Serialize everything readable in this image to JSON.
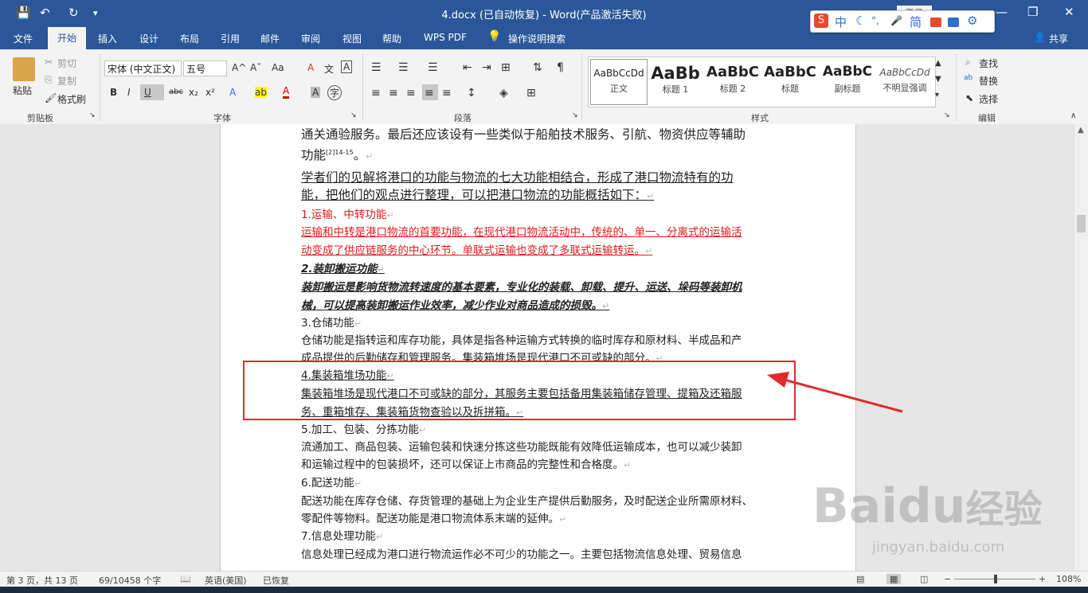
{
  "window": {
    "title": "4.docx (已自动恢复)  -  Word(产品激活失败)",
    "login": "登录",
    "min": "—",
    "restore": "❐",
    "close": "✕"
  },
  "quick_access": {
    "save": "💾",
    "undo": "↶",
    "redo": "↻",
    "more": "▾"
  },
  "ime": {
    "logo": "S",
    "zh": "中",
    "moon": "☾",
    "dots": "°,",
    "mic": "🎤",
    "simp": "简",
    "gear": "⚙"
  },
  "tabs": [
    "文件",
    "开始",
    "插入",
    "设计",
    "布局",
    "引用",
    "邮件",
    "审阅",
    "视图",
    "帮助",
    "WPS PDF",
    "操作说明搜索"
  ],
  "share": "共享",
  "ribbon": {
    "clipboard": {
      "paste": "粘贴",
      "cut": "剪切",
      "copy": "复制",
      "format_painter": "格式刷",
      "label": "剪贴板"
    },
    "font": {
      "name": "宋体 (中文正文)",
      "size": "五号",
      "label": "字体",
      "bold": "B",
      "italic": "I",
      "underline": "U",
      "strike": "abc",
      "sub": "x₂",
      "sup": "x²",
      "grow": "A^",
      "shrink": "Aˇ",
      "case": "Aa",
      "clear": "A",
      "phonetic": "文",
      "border": "A",
      "text_effect": "A",
      "highlight": "ab",
      "color": "A",
      "shade": "A",
      "circle": "字"
    },
    "paragraph": {
      "label": "段落"
    },
    "styles": {
      "label": "样式",
      "items": [
        {
          "sample": "AaBbCcDd",
          "name": "正文"
        },
        {
          "sample": "AaBb",
          "name": "标题 1"
        },
        {
          "sample": "AaBbC",
          "name": "标题 2"
        },
        {
          "sample": "AaBbC",
          "name": "标题"
        },
        {
          "sample": "AaBbC",
          "name": "副标题"
        },
        {
          "sample": "AaBbCcDd",
          "name": "不明显强调"
        }
      ]
    },
    "editing": {
      "find": "查找",
      "replace": "替换",
      "select": "选择",
      "label": "编辑"
    }
  },
  "doc": {
    "lines": [
      "通关通验服务。最后还应该设有一些类似于船舶技术服务、引航、物资供应等辅助",
      "功能",
      "[2]14-15",
      "。",
      "学者们的见解将港口的功能与物流的七大功能相结合，形成了港口物流特有的功",
      "能，把他们的观点进行整理，可以把港口物流的功能概括如下：",
      "1.运输、中转功能",
      "运输和中转是港口物流的首要功能，在现代港口物流活动中，传统的、单一、分离式的运输活",
      "动变成了供应链服务的中心环节。单联式运输也变成了多联式运输转运。",
      "2.装卸搬运功能",
      "装卸搬运是影响货物流转速度的基本要素，专业化的装载、卸载、提升、运送、垛码等装卸机",
      "械，可以提高装卸搬运作业效率，减少作业对商品造成的损毁。",
      "3.仓储功能",
      "仓储功能是指转运和库存功能，具体是指各种运输方式转换的临时库存和原材料、半成品和产",
      "成品提供的后勤储存和管理服务。集装箱堆场是现代港口不可或缺的部分。",
      "4.集装箱堆场功能",
      "集装箱堆场是现代港口不可或缺的部分，其服务主要包括备用集装箱储存管理、提箱及还箱服",
      "务、重箱堆存、集装箱货物查验以及拆拼箱。",
      "5.加工、包装、分拣功能",
      "流通加工、商品包装、运输包装和快速分拣这些功能既能有效降低运输成本，也可以减少装卸",
      "和运输过程中的包装损坏，还可以保证上市商品的完整性和合格度。",
      "6.配送功能",
      "配送功能在库存仓储、存货管理的基础上为企业生产提供后勤服务，及时配送企业所需原材料、",
      "零配件等物料。配送功能是港口物流体系末端的延伸。",
      "7.信息处理功能",
      "信息处理已经成为港口进行物流运作必不可少的功能之一。主要包括物流信息处理、贸易信息"
    ],
    "para_mark": "↵"
  },
  "watermark": {
    "brand": "Baidu",
    "cn": "经验",
    "url": "jingyan.baidu.com"
  },
  "status": {
    "page": "第 3 页，共 13 页",
    "words": "69/10458 个字",
    "lang": "英语(美国)",
    "recovered": "已恢复",
    "zoom": "108%",
    "minus": "−",
    "plus": "+"
  },
  "colors": {
    "accent": "#2b579a",
    "red": "#e21b1b"
  }
}
